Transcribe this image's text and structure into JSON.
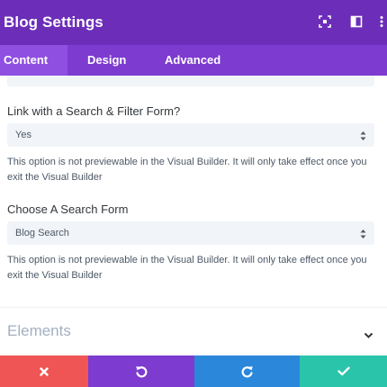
{
  "header": {
    "title": "Blog Settings",
    "icons": [
      "focus-icon",
      "sidebar-toggle-icon",
      "more-options-icon"
    ]
  },
  "tabs": [
    {
      "label": "Content",
      "active": true
    },
    {
      "label": "Design",
      "active": false
    },
    {
      "label": "Advanced",
      "active": false
    }
  ],
  "fields": {
    "search_filter": {
      "label": "Link with a Search & Filter Form?",
      "value": "Yes",
      "note": "This option is not previewable in the Visual Builder. It will only take effect once you exit the Visual Builder"
    },
    "search_form": {
      "label": "Choose A Search Form",
      "value": "Blog Search",
      "note": "This option is not previewable in the Visual Builder. It will only take effect once you exit the Visual Builder"
    }
  },
  "section": {
    "title": "Elements"
  },
  "footer": {
    "buttons": [
      {
        "name": "discard",
        "icon": "close-icon",
        "color": "#ef5555"
      },
      {
        "name": "undo",
        "icon": "undo-icon",
        "color": "#7d3bcf"
      },
      {
        "name": "redo",
        "icon": "redo-icon",
        "color": "#2b87da"
      },
      {
        "name": "save",
        "icon": "checkmark-icon",
        "color": "#29c4a9"
      }
    ]
  },
  "colors": {
    "header_bg": "#6c2eb9",
    "tabs_bg": "#7d3bcf",
    "active_tab_bg": "#8f4fe0"
  }
}
